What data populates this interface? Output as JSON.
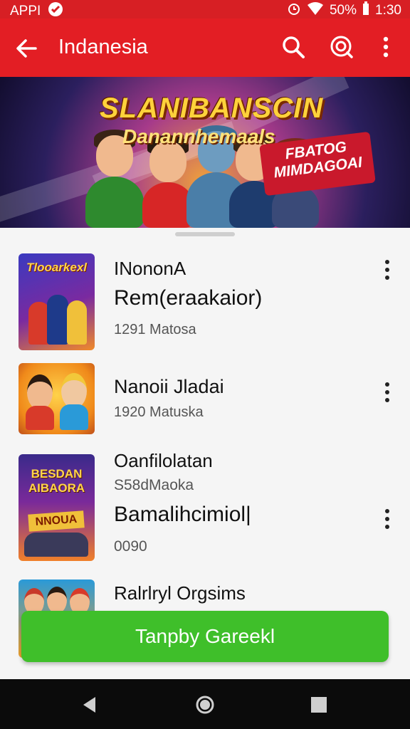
{
  "status": {
    "carrier": "APPI",
    "battery_text": "50%",
    "time": "1:30"
  },
  "header": {
    "title": "Indanesia"
  },
  "banner": {
    "title_line1": "SLANIBANSCIN",
    "title_line2": "Danannhemaals",
    "tag_line1": "FBATOG",
    "tag_line2": "MIMDAGOAI"
  },
  "list": {
    "items": [
      {
        "title": "INononA",
        "subtitle": "Rem(eraakaior)",
        "meta": "1291 Matosa",
        "thumb_text": "Tlooarkexl"
      },
      {
        "title": "Nanoii Jladai",
        "meta": "1920 Matuska"
      },
      {
        "title": "Oanfilolatan",
        "meta2": "S58dMaoka",
        "subtitle": "Bamalihcimiol|",
        "meta": "0090",
        "thumb_text1": "BESDAN",
        "thumb_text2": "AIBAORA",
        "thumb_text3": "NNOUA"
      },
      {
        "title": "Ralrlryl Orgsims"
      }
    ]
  },
  "cta": {
    "label": "Tanpby Gareekl"
  },
  "colors": {
    "accent_red": "#e31e24",
    "cta_green": "#3fbf2a"
  }
}
